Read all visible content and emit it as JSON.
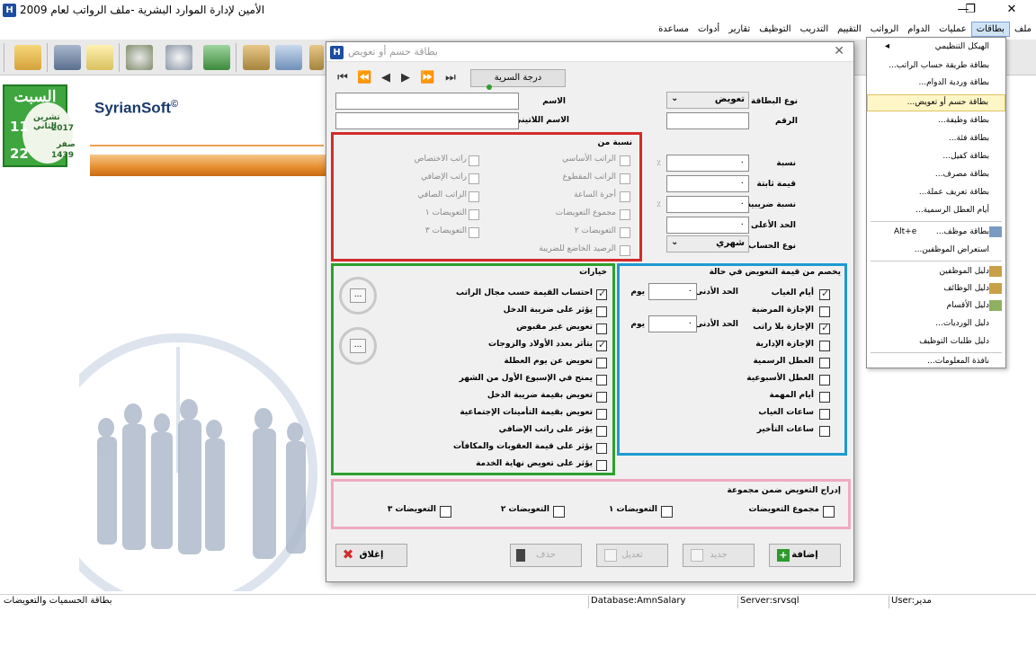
{
  "window": {
    "title": "الأمين لإدارة الموارد البشرية -ملف الرواتب لعام 2009",
    "minimize": "—",
    "restore": "❐",
    "close": "✕"
  },
  "menu": [
    "ملف",
    "بطاقات",
    "عمليات",
    "الدوام",
    "الرواتب",
    "التقييم",
    "التدريب",
    "التوظيف",
    "تقارير",
    "أدوات",
    "مساعدة"
  ],
  "calendar": {
    "weekday": "السبت",
    "greg_day": "11",
    "greg_month": "تشرين الثاني",
    "greg_year": "2017",
    "hijri_day": "22",
    "hijri_month": "صفر",
    "hijri_year": "1439"
  },
  "brand": {
    "logo": "SyrianSoft",
    "copyright": "©"
  },
  "dropdown": {
    "items": [
      "الهيكل التنظيمي",
      "بطاقة طريقة حساب الراتب...",
      "بطاقة وردية الدوام...",
      "بطاقة حسم أو تعويض...",
      "بطاقة وظيفة...",
      "بطاقة فئة...",
      "بطاقة كفيل...",
      "بطاقة مصرف...",
      "بطاقة تعريف عملة...",
      "أيام العطل الرسمية...",
      "بطاقة موظف...",
      "استعراض الموظفين...",
      "دليل الموظفين",
      "دليل الوظائف",
      "دليل الأقسام",
      "دليل الورديات...",
      "دليل طلبات التوظيف",
      "نافذة المعلومات..."
    ],
    "submenu_arrow": "◂",
    "shortcut_employee": "Alt+e",
    "selected": "بطاقة حسم أو تعويض..."
  },
  "dialog": {
    "title": "بطاقة حسم أو تعويض",
    "close": "✕",
    "nav": [
      "⏮",
      "⏪",
      "◀",
      "▶",
      "⏩",
      "⏭"
    ],
    "secrecy_button": "درجة السرية",
    "card_type_label": "نوع البطاقة",
    "card_type_value": "تعويض",
    "number_label": "الرقم",
    "name_label": "الاسم",
    "latin_name_label": "الاسم اللاتيني",
    "percentage_label": "نسبة",
    "fixed_value_label": "قيمة ثابتة",
    "tax_rate_label": "نسبة ضريبية",
    "max_label": "الحد الأعلى",
    "calc_type_label": "نوع الحساب",
    "calc_type_value": "شهري",
    "percent_sign": "٪",
    "zero": "٠",
    "ratio_from": {
      "title": "نسبة من",
      "items": [
        "الراتب الأساسي",
        "راتب الاختصاص",
        "الراتب المقطوع",
        "راتب الإضافي",
        "أجرة الساعة",
        "الراتب الصافي",
        "مجموع التعويضات",
        "التعويضات ١",
        "التعويضات ٢",
        "التعويضات ٣",
        "الرصيد الخاضع للضريبة"
      ]
    },
    "options": {
      "title": "خيارات",
      "items": [
        "احتساب القيمة حسب مجال الراتب",
        "يؤثر على ضريبة الدخل",
        "تعويض غير مقبوض",
        "يتأثر بعدد الأولاد والزوجات",
        "تعويض عن يوم العطلة",
        "يمنح في الإسبوع الأول من الشهر",
        "تعويض بقيمة ضريبة الدخل",
        "تعويض بقيمة التأمينات الإجتماعية",
        "يؤثر على راتب الإضافي",
        "يؤثر على قيمة العقوبات والمكافآت",
        "يؤثر على تعويض نهاية الخدمة"
      ],
      "ellipsis": "..."
    },
    "deduct": {
      "title": "يخصم من قيمة التعويض في حالة",
      "items": [
        "أيام الغياب",
        "الإجازة المرضية",
        "الإجازة بلا راتب",
        "الإجازة الإدارية",
        "العطل الرسمية",
        "العطل الأسبوعية",
        "أيام المهمة",
        "ساعات الغياب",
        "ساعات التأخير"
      ],
      "min_label": "الحد الأدنى",
      "unit": "يوم"
    },
    "group": {
      "title": "إدراج التعويض ضمن مجموعة",
      "items": [
        "مجموع التعويضات",
        "التعويضات ١",
        "التعويضات ٢",
        "التعويضات ٣"
      ]
    },
    "buttons": {
      "add": "إضافة",
      "new": "جديد",
      "edit": "تعديل",
      "delete": "حذف",
      "close": "إغلاق"
    }
  },
  "status": {
    "left": "بطاقة الحسميات والتعويضات",
    "database": "Database:AmnSalary",
    "server": "Server:srvsql",
    "user": "User:مدير"
  }
}
